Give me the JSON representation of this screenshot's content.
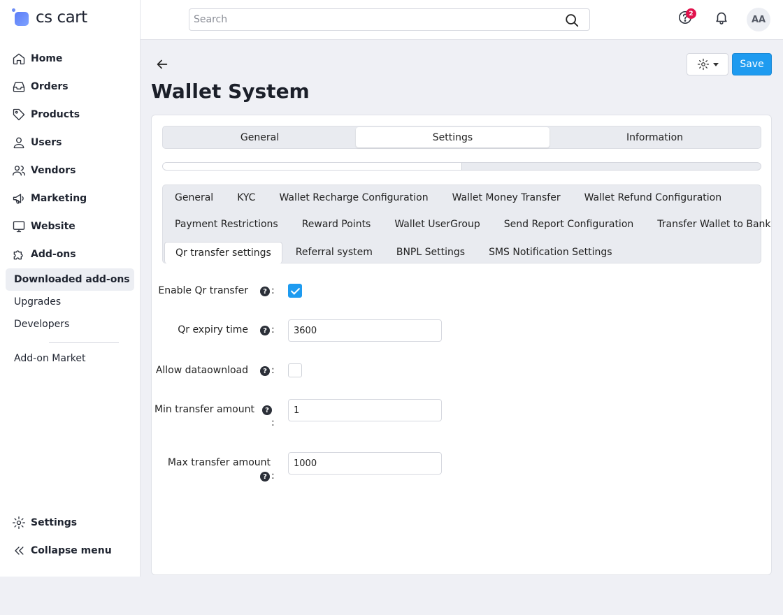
{
  "brand": {
    "name": "cs cart"
  },
  "sidebar": {
    "items": [
      {
        "label": "Home",
        "icon": "home-icon"
      },
      {
        "label": "Orders",
        "icon": "inbox-icon"
      },
      {
        "label": "Products",
        "icon": "tag-icon"
      },
      {
        "label": "Users",
        "icon": "user-icon"
      },
      {
        "label": "Vendors",
        "icon": "users-icon"
      },
      {
        "label": "Marketing",
        "icon": "megaphone-icon"
      },
      {
        "label": "Website",
        "icon": "monitor-icon"
      },
      {
        "label": "Add-ons",
        "icon": "puzzle-icon"
      }
    ],
    "addons_sub": [
      "Downloaded add-ons",
      "Upgrades",
      "Developers"
    ],
    "addon_market": "Add-on Market",
    "settings": "Settings",
    "collapse": "Collapse menu"
  },
  "header": {
    "search_placeholder": "Search",
    "help_badge": "2",
    "avatar": "AA"
  },
  "page": {
    "title": "Wallet System",
    "save_label": "Save"
  },
  "tabs": [
    "General",
    "Settings",
    "Information"
  ],
  "active_tab": "Settings",
  "progress_fraction": 0.5,
  "subtabs": [
    [
      "General",
      "KYC",
      "Wallet Recharge Configuration",
      "Wallet Money Transfer",
      "Wallet Refund Configuration"
    ],
    [
      "Payment Restrictions",
      "Reward Points",
      "Wallet UserGroup",
      "Send Report Configuration",
      "Transfer Wallet to Bank"
    ],
    [
      "Qr transfer settings",
      "Referral system",
      "BNPL Settings",
      "SMS Notification Settings"
    ]
  ],
  "active_subtab": "Qr transfer settings",
  "form": {
    "enable_qr_label": "Enable Qr transfer",
    "enable_qr_checked": true,
    "qr_expiry_label": "Qr expiry time",
    "qr_expiry_value": "3600",
    "allow_download_label": "Allow dataownload",
    "allow_download_checked": false,
    "min_label": "Min transfer amount",
    "min_value": "1",
    "max_label": "Max transfer amount",
    "max_value": "1000",
    "help_glyph": "?",
    "colon": ":"
  }
}
